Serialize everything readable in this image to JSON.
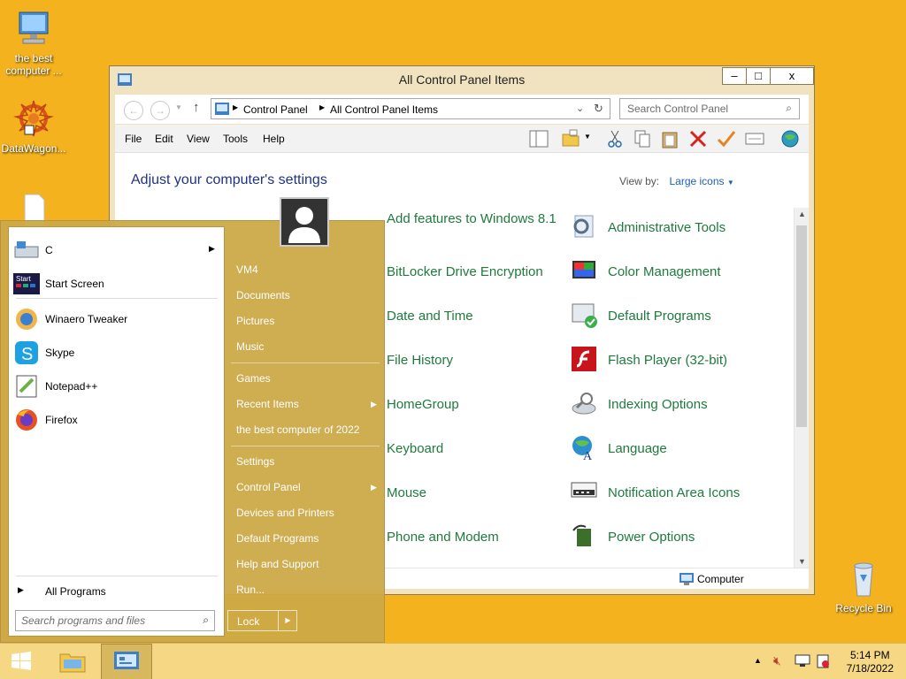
{
  "desktop": {
    "icons": [
      {
        "label": "the best computer ...",
        "icon": "computer-icon"
      },
      {
        "label": "DataWagon...",
        "icon": "datawagon-icon"
      },
      {
        "label": "",
        "icon": "file-icon"
      },
      {
        "label": "Recycle Bin",
        "icon": "recycle-bin-icon"
      }
    ]
  },
  "window": {
    "title": "All Control Panel Items",
    "controls": {
      "minimize": "–",
      "maximize": "□",
      "close": "x"
    },
    "address": {
      "crumbs": [
        "Control Panel",
        "All Control Panel Items"
      ]
    },
    "search_placeholder": "Search Control Panel",
    "menu": [
      "File",
      "Edit",
      "View",
      "Tools",
      "Help"
    ],
    "heading": "Adjust your computer's settings",
    "view_by_label": "View by:",
    "view_by_value": "Large icons",
    "items_left": [
      "Add features to Windows 8.1",
      "BitLocker Drive Encryption",
      "Date and Time",
      "File History",
      "HomeGroup",
      "Keyboard",
      "Mouse",
      "Phone and Modem"
    ],
    "items_right": [
      "Administrative Tools",
      "Color Management",
      "Default Programs",
      "Flash Player (32-bit)",
      "Indexing Options",
      "Language",
      "Notification Area Icons",
      "Power Options"
    ],
    "status": "Computer"
  },
  "startmenu": {
    "programs": [
      {
        "label": "C",
        "icon": "drive-icon"
      },
      {
        "label": "Start Screen",
        "icon": "start-screen-icon"
      },
      {
        "label": "Winaero Tweaker",
        "icon": "winaero-icon"
      },
      {
        "label": "Skype",
        "icon": "skype-icon"
      },
      {
        "label": "Notepad++",
        "icon": "notepadpp-icon"
      },
      {
        "label": "Firefox",
        "icon": "firefox-icon"
      }
    ],
    "all_programs": "All Programs",
    "search_placeholder": "Search programs and files",
    "right": [
      "VM4",
      "Documents",
      "Pictures",
      "Music",
      "Games",
      "Recent Items",
      "the best computer of 2022",
      "Settings",
      "Control Panel",
      "Devices and Printers",
      "Default Programs",
      "Help and Support",
      "Run..."
    ],
    "lock": "Lock"
  },
  "taskbar": {
    "time": "5:14 PM",
    "date": "7/18/2022"
  },
  "colors": {
    "desktop": "#f3b21e",
    "link_green": "#1f7a3c",
    "heading_blue": "#1e3287"
  }
}
